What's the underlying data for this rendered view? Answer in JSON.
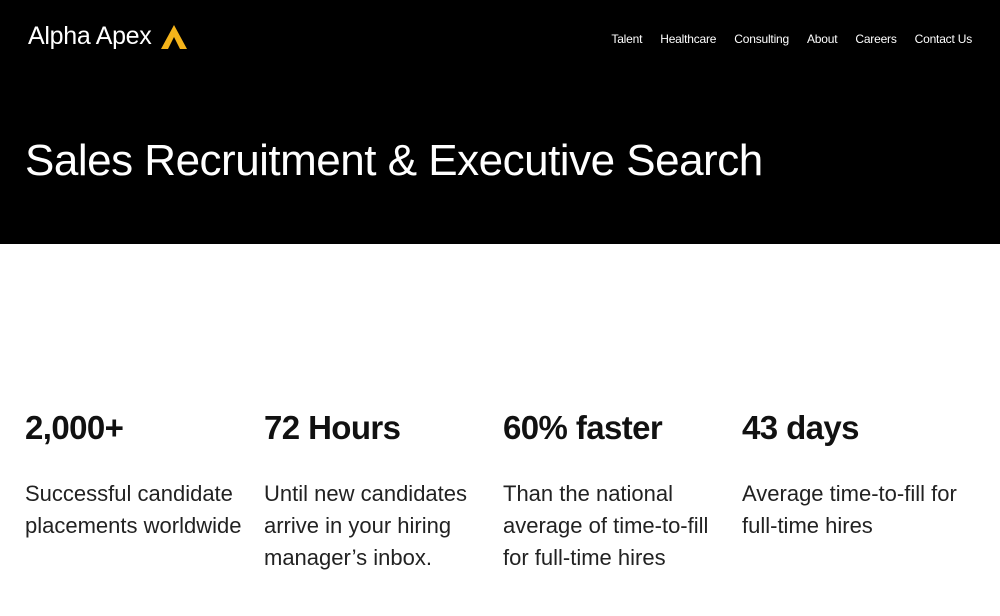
{
  "header": {
    "logo_text": "Alpha Apex",
    "logo_icon": "apex-triangle-icon",
    "accent_color": "#F5B41A",
    "nav": [
      {
        "label": "Talent"
      },
      {
        "label": "Healthcare"
      },
      {
        "label": "Consulting"
      },
      {
        "label": "About"
      },
      {
        "label": "Careers"
      },
      {
        "label": "Contact Us"
      }
    ]
  },
  "hero": {
    "title": "Sales Recruitment & Executive Search"
  },
  "stats": [
    {
      "value": "2,000+",
      "description": "Successful candidate placements worldwide"
    },
    {
      "value": "72 Hours",
      "description": "Until new candidates arrive in your hiring manager’s inbox."
    },
    {
      "value": "60% faster",
      "description": "Than the national average of time-to-fill for full-time hires"
    },
    {
      "value": "43 days",
      "description": "Average time-to-fill for full-time hires"
    }
  ]
}
